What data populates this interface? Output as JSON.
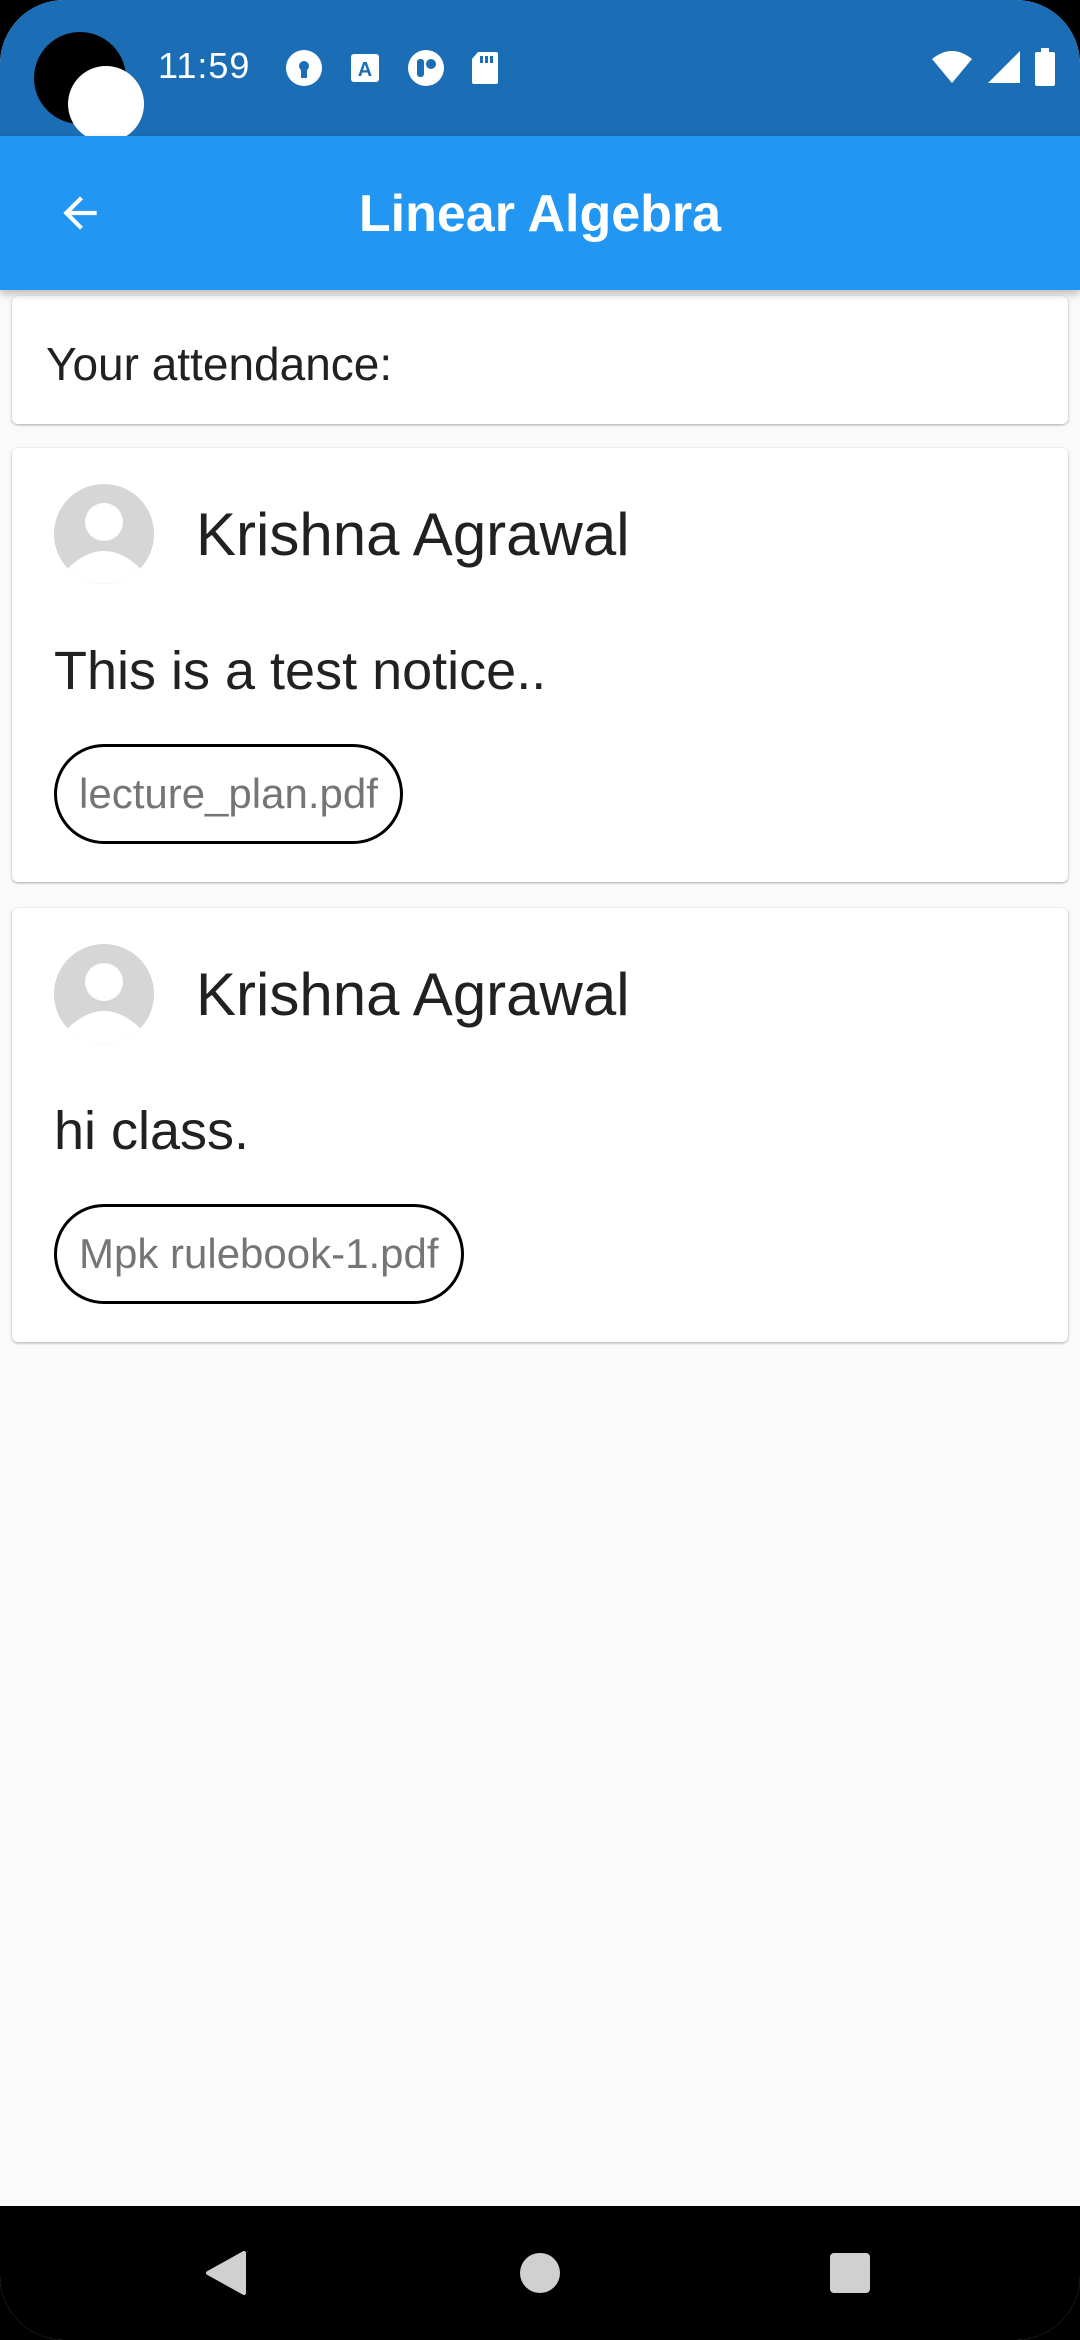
{
  "status_bar": {
    "time": "11:59",
    "left_icons": [
      "vpn-key-icon",
      "a-keyboard-icon",
      "toggle-app-icon",
      "sd-card-icon"
    ],
    "right_icons": [
      "wifi-icon",
      "signal-icon",
      "battery-icon"
    ]
  },
  "app_bar": {
    "title": "Linear Algebra",
    "back_icon": "arrow-back-icon",
    "color": "#2196f3"
  },
  "attendance": {
    "label": "Your attendance:"
  },
  "notices": [
    {
      "author": "Krishna Agrawal",
      "text": "This is a test notice..",
      "attachment": "lecture_plan.pdf"
    },
    {
      "author": "Krishna Agrawal",
      "text": "hi class.",
      "attachment": "Mpk rulebook-1.pdf"
    }
  ],
  "colors": {
    "status_bar": "#1b6eb5",
    "app_bar": "#2196f3",
    "background": "#fafafa"
  }
}
